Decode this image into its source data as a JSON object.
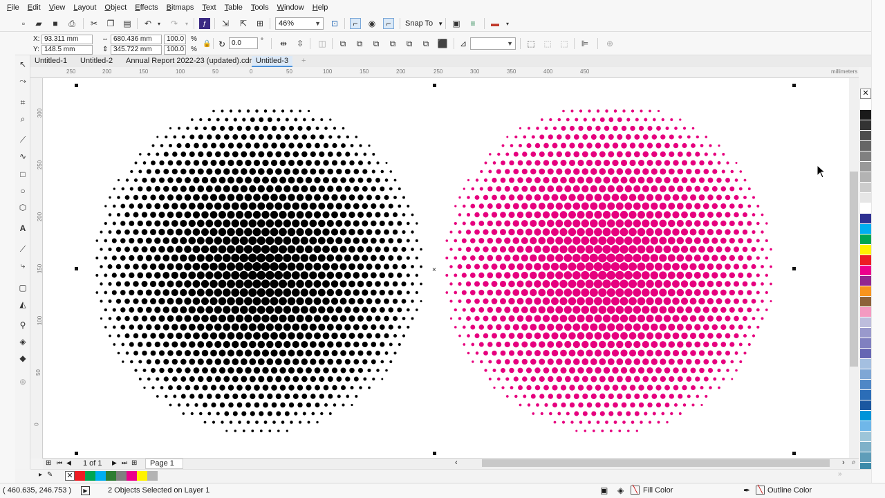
{
  "menu": [
    "File",
    "Edit",
    "View",
    "Layout",
    "Object",
    "Effects",
    "Bitmaps",
    "Text",
    "Table",
    "Tools",
    "Window",
    "Help"
  ],
  "toolbar": {
    "zoom": "46%",
    "snap_label": "Snap To"
  },
  "props": {
    "x_label": "X:",
    "y_label": "Y:",
    "x": "93.311 mm",
    "y": "148.5 mm",
    "width": "680.436 mm",
    "height": "345.722 mm",
    "scale_w": "100.0",
    "scale_h": "100.0",
    "pct": "%",
    "rotation": "0.0",
    "degree": "°"
  },
  "tabs": [
    "Untitled-1",
    "Untitled-2",
    "Annual Report 2022-23 (updated).cdr",
    "Untitled-3"
  ],
  "active_tab": 3,
  "ruler": {
    "unit": "millimeters",
    "h_ticks": [
      "250",
      "200",
      "150",
      "100",
      "50",
      "0",
      "50",
      "100",
      "150",
      "200",
      "250",
      "300",
      "350",
      "400",
      "450"
    ],
    "v_ticks": [
      "300",
      "250",
      "200",
      "150",
      "100",
      "50",
      "0"
    ]
  },
  "canvas": {
    "left_circle_color": "#000000",
    "right_circle_color": "#e6007e"
  },
  "palette_colors": [
    "#ffffff",
    "#1a1a1a",
    "#333333",
    "#4d4d4d",
    "#666666",
    "#808080",
    "#999999",
    "#b3b3b3",
    "#cccccc",
    "#e6e6e6",
    "#ffffff",
    "#2e3192",
    "#00aeef",
    "#00a651",
    "#fff200",
    "#ed1c24",
    "#ec008c",
    "#92278f",
    "#f7941d",
    "#8c6239",
    "#f49ac1",
    "#bdbddc",
    "#9999cc",
    "#8080c0",
    "#6666b3",
    "#a4bfe0",
    "#7fa7d5",
    "#4f87c6",
    "#2b6db7",
    "#1a57a0",
    "#0094d9",
    "#6fb7e9",
    "#9dc5d9",
    "#7fb1c9",
    "#5f9db9",
    "#3d8aa9"
  ],
  "docnav": {
    "page_count": "1 of 1",
    "page_tab": "Page 1"
  },
  "doc_palette": [
    "#ed1c24",
    "#00a651",
    "#00aeef",
    "#2e7d32",
    "#808080",
    "#ec008c",
    "#fff200",
    "#b3b3b3"
  ],
  "status": {
    "coords": "( 460.635, 246.753 )",
    "selection": "2 Objects Selected on Layer 1",
    "fill_label": "Fill Color",
    "outline_label": "Outline Color"
  }
}
